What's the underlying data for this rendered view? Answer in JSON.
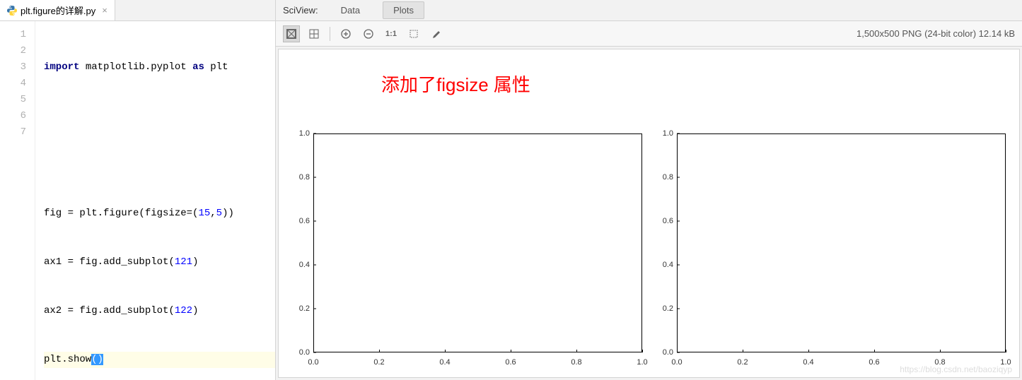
{
  "editor": {
    "tab_filename": "plt.figure的详解.py",
    "line_numbers": [
      "1",
      "2",
      "3",
      "4",
      "5",
      "6",
      "7"
    ],
    "code": {
      "l1": {
        "kw1": "import",
        "mid": " matplotlib.pyplot ",
        "kw2": "as",
        "tail": " plt"
      },
      "l4": {
        "pre": "fig = plt.figure(",
        "arg": "figsize",
        "eq": "=(",
        "n1": "15",
        "comma": ",",
        "n2": "5",
        "post": "))"
      },
      "l5": {
        "pre": "ax1 = fig.add_subplot(",
        "n": "121",
        "post": ")"
      },
      "l6": {
        "pre": "ax2 = fig.add_subplot(",
        "n": "122",
        "post": ")"
      },
      "l7": {
        "pre": "plt.show",
        "paren": "()"
      }
    }
  },
  "sciview": {
    "title": "SciView:",
    "tab_data": "Data",
    "tab_plots": "Plots",
    "image_info": "1,500x500 PNG (24-bit color) 12.14 kB",
    "toolbar": {
      "one_to_one": "1:1"
    }
  },
  "annotation": "添加了figsize 属性",
  "chart_data": [
    {
      "type": "line",
      "title": "",
      "xlabel": "",
      "ylabel": "",
      "xlim": [
        0.0,
        1.0
      ],
      "ylim": [
        0.0,
        1.0
      ],
      "xticks": [
        "0.0",
        "0.2",
        "0.4",
        "0.6",
        "0.8",
        "1.0"
      ],
      "yticks": [
        "0.0",
        "0.2",
        "0.4",
        "0.6",
        "0.8",
        "1.0"
      ],
      "series": []
    },
    {
      "type": "line",
      "title": "",
      "xlabel": "",
      "ylabel": "",
      "xlim": [
        0.0,
        1.0
      ],
      "ylim": [
        0.0,
        1.0
      ],
      "xticks": [
        "0.0",
        "0.2",
        "0.4",
        "0.6",
        "0.8",
        "1.0"
      ],
      "yticks": [
        "0.0",
        "0.2",
        "0.4",
        "0.6",
        "0.8",
        "1.0"
      ],
      "series": []
    }
  ],
  "watermark": "https://blog.csdn.net/baoziqyp"
}
